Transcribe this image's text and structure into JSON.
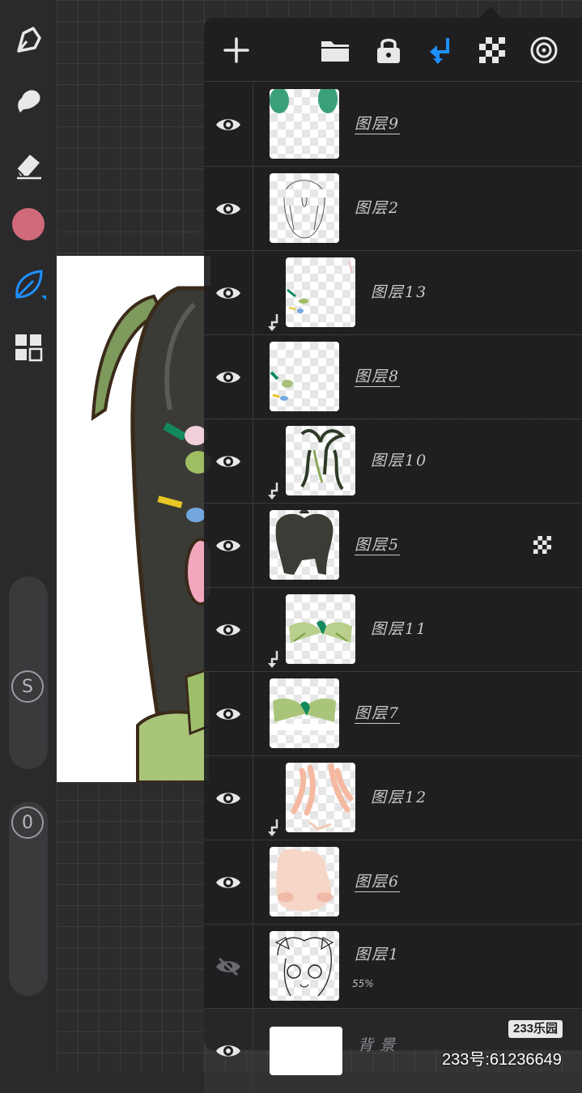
{
  "toolbar": {
    "color_swatch": "#d06a7a",
    "accent": "#1e90ff",
    "size_slider_label": "S",
    "opacity_slider_label": "0"
  },
  "layers_panel": {
    "header": {
      "add": "plus-icon",
      "folder": "folder-icon",
      "lock": "lock-icon",
      "clip": "clip-arrow-icon",
      "alpha": "checker-icon",
      "blend": "target-icon"
    },
    "layers": [
      {
        "name": "图层9",
        "visible": true,
        "clipped": false,
        "selected": true
      },
      {
        "name": "图层2",
        "visible": true,
        "clipped": false,
        "selected": false
      },
      {
        "name": "图层13",
        "visible": true,
        "clipped": true,
        "selected": false
      },
      {
        "name": "图层8",
        "visible": true,
        "clipped": false,
        "selected": true
      },
      {
        "name": "图层10",
        "visible": true,
        "clipped": true,
        "selected": false
      },
      {
        "name": "图层5",
        "visible": true,
        "clipped": false,
        "selected": true,
        "alpha_lock": true
      },
      {
        "name": "图层11",
        "visible": true,
        "clipped": true,
        "selected": false
      },
      {
        "name": "图层7",
        "visible": true,
        "clipped": false,
        "selected": true
      },
      {
        "name": "图层12",
        "visible": true,
        "clipped": true,
        "selected": false
      },
      {
        "name": "图层6",
        "visible": true,
        "clipped": false,
        "selected": true
      },
      {
        "name": "图层1",
        "visible": false,
        "clipped": false,
        "selected": false,
        "opacity": "55%"
      },
      {
        "name": "背景",
        "visible": true,
        "clipped": false,
        "selected": false
      }
    ]
  },
  "watermark": {
    "badge": "233乐园",
    "id_text": "233号:61236649"
  }
}
